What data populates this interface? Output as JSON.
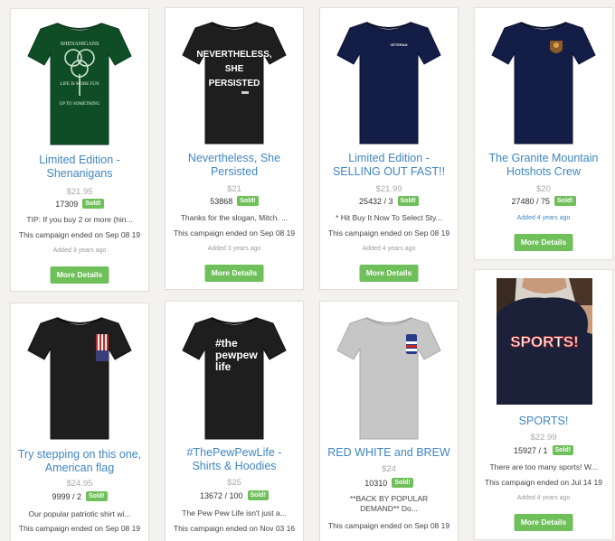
{
  "products": [
    {
      "title": "Limited Edition - Shenanigans",
      "price": "$21.95",
      "stat": "17309",
      "sold": "Sold!",
      "desc": "TIP: If you buy 2 or more (hin...",
      "ended": "This campaign ended on Sep 08 19",
      "added": "Added 3 years ago",
      "button": "More Details",
      "shirt_color": "#0f4d26",
      "graphic_text": [
        "SHENANIGANS",
        "LIFE IS MORE FUN",
        "UP TO SOMETHING"
      ],
      "graphic_icon": "shamrock-icon"
    },
    {
      "title": "Nevertheless, She Persisted",
      "price": "$21",
      "stat": "53868",
      "sold": "Sold!",
      "desc": "Thanks for the slogan, Mitch. ...",
      "ended": "This campaign ended on Sep 08 19",
      "added": "Added 3 years ago",
      "button": "More Details",
      "shirt_color": "#1e1e1e",
      "graphic_text": [
        "NEVERTHELESS,",
        "SHE",
        "PERSISTED"
      ]
    },
    {
      "title": "Limited Edition - SELLING OUT FAST!!",
      "price": "$21.99",
      "stat": "25432 / 3",
      "sold": "Sold!",
      "desc": "* Hit Buy It Now To Select Sty...",
      "ended": "This campaign ended on Sep 08 19",
      "added": "Added 4 years ago",
      "button": "More Details",
      "shirt_color": "#141d45",
      "graphic_text": [
        "VETERAN"
      ]
    },
    {
      "title": "The Granite Mountain Hotshots Crew",
      "price": "$20",
      "stat": "27480 / 75",
      "sold": "Sold!",
      "added": "Added 4 years ago",
      "button": "More Details",
      "shirt_color": "#141d45",
      "graphic_icon": "badge-icon"
    },
    {
      "title": "Try stepping on this one, American flag",
      "price": "$24.95",
      "stat": "9999 / 2",
      "sold": "Sold!",
      "desc": "Our popular patriotic shirt wi...",
      "ended": "This campaign ended on Sep 08 19",
      "shirt_color": "#1e1e1e",
      "graphic_icon": "american-flag-icon"
    },
    {
      "title": "#ThePewPewLife - Shirts & Hoodies",
      "price": "$25",
      "stat": "13672 / 100",
      "sold": "Sold!",
      "desc": "The Pew Pew Life isn't just a...",
      "ended": "This campaign ended on Nov 03 16",
      "shirt_color": "#1e1e1e",
      "graphic_text": [
        "#the",
        "pewpew",
        "life"
      ]
    },
    {
      "title": "RED WHITE and BREW",
      "price": "$24",
      "stat": "10310",
      "sold": "Sold!",
      "desc": "**BACK BY POPULAR\nDEMAND** Do...",
      "ended": "This campaign ended on Sep 08 19",
      "shirt_color": "#c6c6c6",
      "graphic_icon": "flag-can-icon"
    },
    {
      "title": "SPORTS!",
      "price": "$22.99",
      "stat": "15927 / 1",
      "sold": "Sold!",
      "desc": "There are too many sports!  W...",
      "ended": "This campaign ended on Jul 14 19",
      "added": "Added 4 years ago",
      "button": "More Details",
      "shirt_color": "#1a2138",
      "graphic_text": [
        "SPORTS!"
      ]
    }
  ]
}
